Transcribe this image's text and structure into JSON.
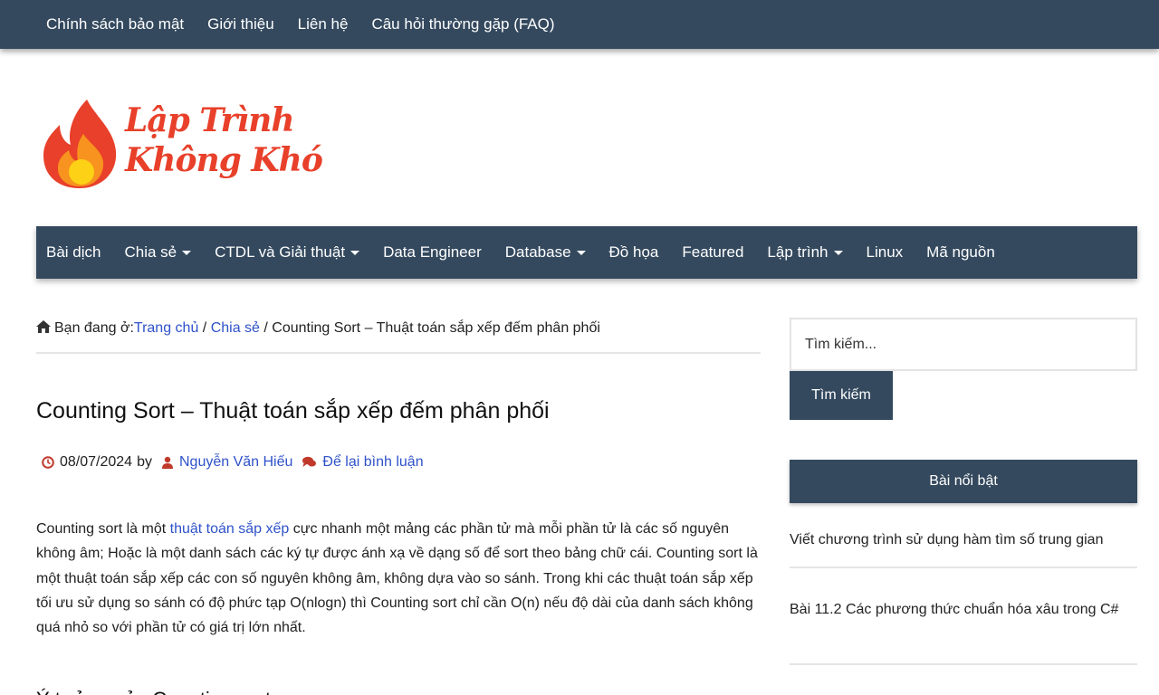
{
  "topbar": {
    "items": [
      "Chính sách bảo mật",
      "Giới thiệu",
      "Liên hệ",
      "Câu hỏi thường gặp (FAQ)"
    ]
  },
  "logo": {
    "line1": "Lập Trình",
    "line2": "Không Khó"
  },
  "mainnav": {
    "items": [
      {
        "label": "Bài dịch",
        "dropdown": false
      },
      {
        "label": "Chia sẻ",
        "dropdown": true
      },
      {
        "label": "CTDL và Giải thuật",
        "dropdown": true
      },
      {
        "label": "Data Engineer",
        "dropdown": false
      },
      {
        "label": "Database",
        "dropdown": true
      },
      {
        "label": "Đồ họa",
        "dropdown": false
      },
      {
        "label": "Featured",
        "dropdown": false
      },
      {
        "label": "Lập trình",
        "dropdown": true
      },
      {
        "label": "Linux",
        "dropdown": false
      },
      {
        "label": "Mã nguồn",
        "dropdown": false
      }
    ]
  },
  "breadcrumb": {
    "prefix": "Bạn đang ở:",
    "home": "Trang chủ",
    "sep1": " / ",
    "category": "Chia sẻ",
    "sep2": " / ",
    "current": "Counting Sort – Thuật toán sắp xếp đếm phân phối"
  },
  "article": {
    "title": "Counting Sort – Thuật toán sắp xếp đếm phân phối",
    "date": "08/07/2024",
    "by": "by",
    "author": "Nguyễn Văn Hiếu",
    "comment_link": "Để lại bình luận",
    "para_before_link": "Counting sort là một ",
    "para_link": "thuật toán sắp xếp",
    "para_after_link": " cực nhanh một mảng các phần tử mà mỗi phần tử là các số nguyên không âm; Hoặc là một danh sách các ký tự được ánh xạ về dạng số để sort theo bảng chữ cái. Counting sort là một thuật toán sắp xếp các con số nguyên không âm, không dựa vào so sánh. Trong khi các thuật toán sắp xếp tối ưu sử dụng so sánh có độ phức tạp O(nlogn) thì Counting sort chỉ cần O(n) nếu độ dài của danh sách không quá nhỏ so với phần tử có giá trị lớn nhất.",
    "next_heading": "Ý tưởng của Counting sort"
  },
  "sidebar": {
    "search_placeholder": "Tìm kiếm...",
    "search_button": "Tìm kiếm",
    "widget_title": "Bài nổi bật",
    "posts": [
      "Viết chương trình sử dụng hàm tìm số trung gian",
      "Bài 11.2 Các phương thức chuẩn hóa xâu trong C#"
    ]
  },
  "colors": {
    "nav": "#34495e",
    "link": "#2f52c9",
    "brand": "#e8402a"
  }
}
